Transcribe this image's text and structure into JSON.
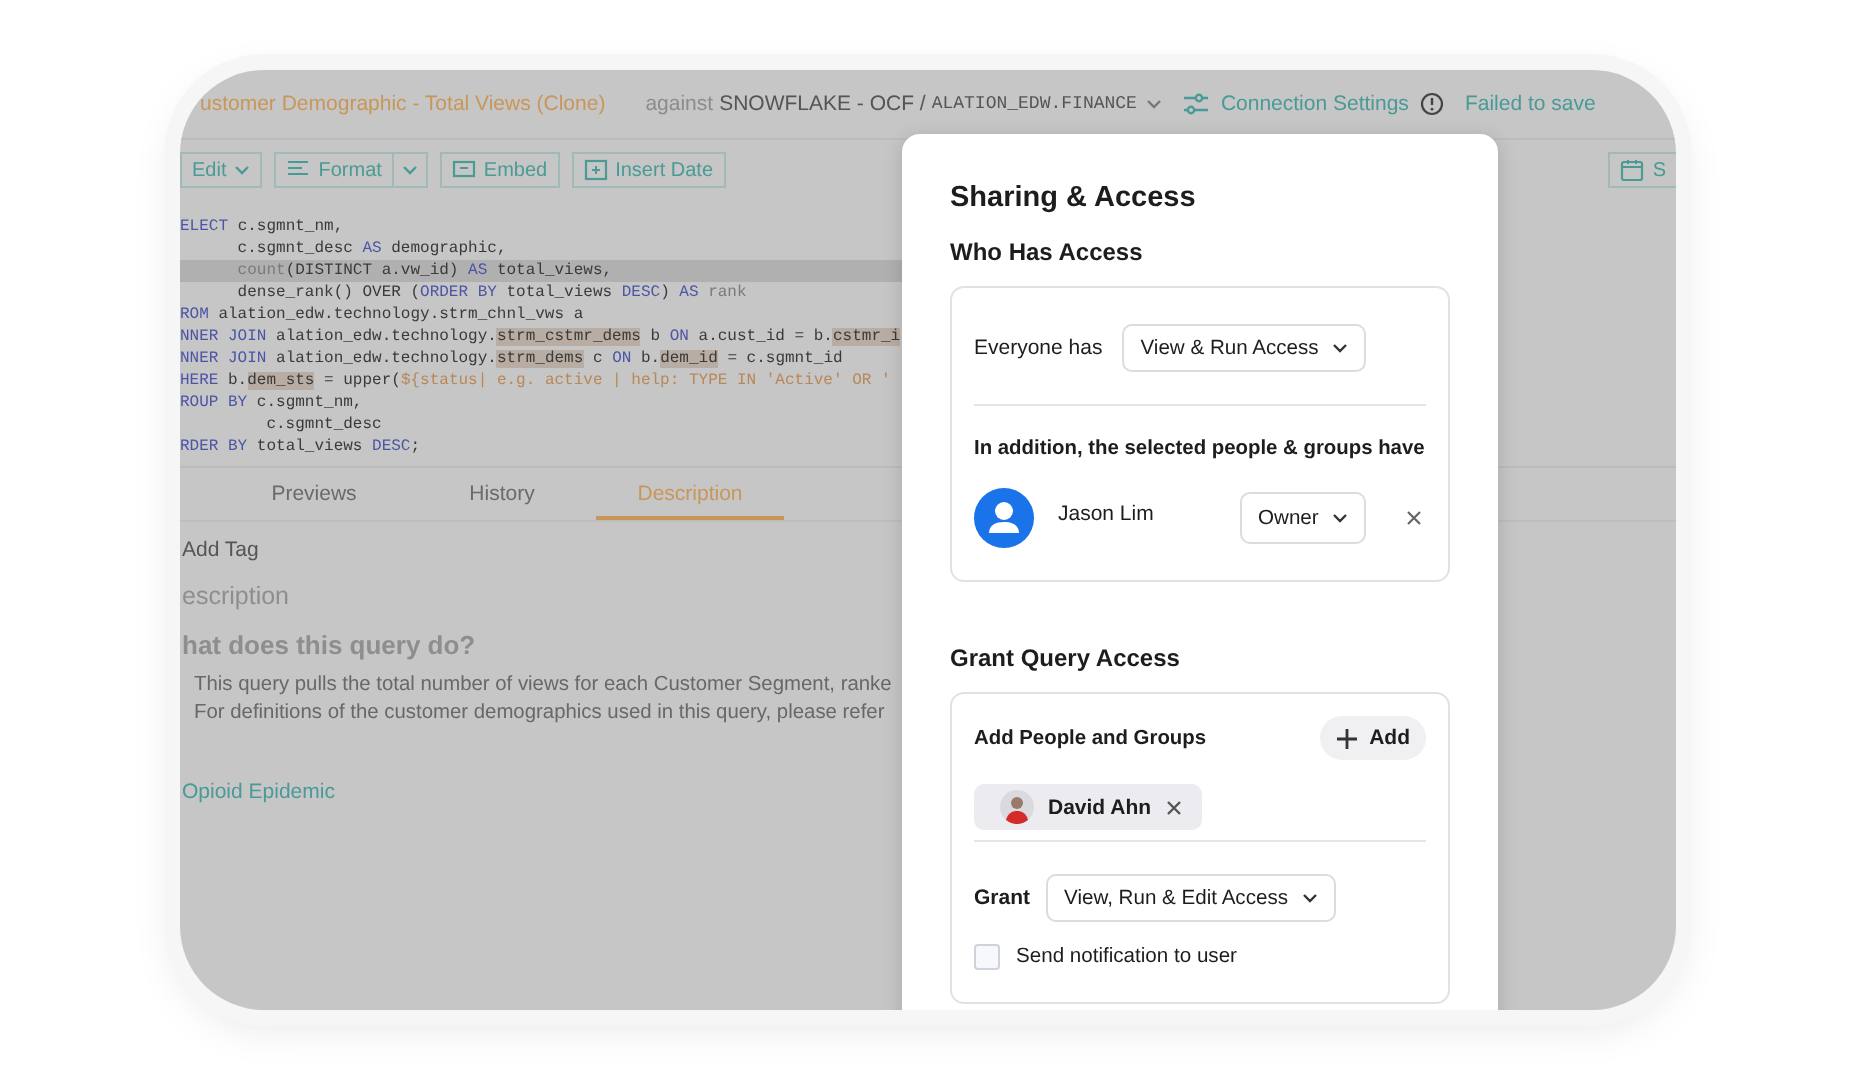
{
  "editor": {
    "title": "ustomer Demographic - Total Views (Clone)",
    "against": "against",
    "connection": "SNOWFLAKE - OCF /",
    "schema": "ALATION_EDW.FINANCE",
    "connection_settings": "Connection Settings",
    "save_status": "Failed to save",
    "toolbar": [
      {
        "label": "Edit",
        "kind": "dropdown"
      },
      {
        "label": "Format",
        "kind": "split"
      },
      {
        "label": "Embed",
        "kind": "embed"
      },
      {
        "label": "Insert Date",
        "kind": "date"
      }
    ],
    "toolbar_right": {
      "label": "S",
      "kind": "calendar"
    },
    "code_lines": [
      {
        "highlighted": false,
        "segments": [
          {
            "kind": "kw",
            "text": "ELECT"
          },
          {
            "kind": "plain",
            "text": " c.sgmnt_nm,"
          }
        ]
      },
      {
        "highlighted": false,
        "segments": [
          {
            "kind": "plain",
            "text": "      c.sgmnt_desc "
          },
          {
            "kind": "kw",
            "text": "AS"
          },
          {
            "kind": "plain",
            "text": " demographic,"
          }
        ]
      },
      {
        "highlighted": true,
        "segments": [
          {
            "kind": "fn",
            "text": "      count"
          },
          {
            "kind": "plain",
            "text": "(DISTINCT a.vw_id) "
          },
          {
            "kind": "kw",
            "text": "AS"
          },
          {
            "kind": "plain",
            "text": " total_views,"
          }
        ]
      },
      {
        "highlighted": false,
        "segments": [
          {
            "kind": "plain",
            "text": "      dense_rank() OVER ("
          },
          {
            "kind": "kw",
            "text": "ORDER BY"
          },
          {
            "kind": "plain",
            "text": " total_views "
          },
          {
            "kind": "kw",
            "text": "DESC"
          },
          {
            "kind": "plain",
            "text": ") "
          },
          {
            "kind": "kw",
            "text": "AS"
          },
          {
            "kind": "fn",
            "text": " rank"
          }
        ]
      },
      {
        "highlighted": false,
        "segments": [
          {
            "kind": "kw",
            "text": "ROM"
          },
          {
            "kind": "plain",
            "text": " alation_edw.technology.strm_chnl_vws a"
          }
        ]
      },
      {
        "highlighted": false,
        "segments": [
          {
            "kind": "kw",
            "text": "NNER JOIN"
          },
          {
            "kind": "plain",
            "text": " alation_edw.technology."
          },
          {
            "kind": "mark",
            "text": "strm_cstmr_dems"
          },
          {
            "kind": "plain",
            "text": " b "
          },
          {
            "kind": "kw",
            "text": "ON"
          },
          {
            "kind": "plain",
            "text": " a.cust_id = b."
          },
          {
            "kind": "mark",
            "text": "cstmr_i"
          }
        ]
      },
      {
        "highlighted": false,
        "segments": [
          {
            "kind": "kw",
            "text": "NNER JOIN"
          },
          {
            "kind": "plain",
            "text": " alation_edw.technology."
          },
          {
            "kind": "mark",
            "text": "strm_dems"
          },
          {
            "kind": "plain",
            "text": " c "
          },
          {
            "kind": "kw",
            "text": "ON"
          },
          {
            "kind": "plain",
            "text": " b."
          },
          {
            "kind": "mark",
            "text": "dem_id"
          },
          {
            "kind": "plain",
            "text": " = c.sgmnt_id"
          }
        ]
      },
      {
        "highlighted": false,
        "segments": [
          {
            "kind": "kw",
            "text": "HERE"
          },
          {
            "kind": "plain",
            "text": " b."
          },
          {
            "kind": "mark",
            "text": "dem_sts"
          },
          {
            "kind": "plain",
            "text": " = upper("
          },
          {
            "kind": "param",
            "text": "${status| e.g. active | help: TYPE IN 'Active' OR '"
          }
        ]
      },
      {
        "highlighted": false,
        "segments": [
          {
            "kind": "kw",
            "text": "ROUP BY"
          },
          {
            "kind": "plain",
            "text": " c.sgmnt_nm,"
          }
        ]
      },
      {
        "highlighted": false,
        "segments": [
          {
            "kind": "plain",
            "text": "         c.sgmnt_desc"
          }
        ]
      },
      {
        "highlighted": false,
        "segments": [
          {
            "kind": "kw",
            "text": "RDER BY"
          },
          {
            "kind": "plain",
            "text": " total_views "
          },
          {
            "kind": "kw",
            "text": "DESC"
          },
          {
            "kind": "plain",
            "text": ";"
          }
        ]
      }
    ],
    "tabs": [
      {
        "label": "Previews",
        "selected": false
      },
      {
        "label": "History",
        "selected": false
      },
      {
        "label": "Description",
        "selected": true
      }
    ],
    "add_tag": "Add Tag",
    "section_title": "escription",
    "heading": "hat does this query do?",
    "paragraph_lines": [
      "This query pulls the total number of views for each Customer Segment, ranke",
      "For definitions of the customer demographics used in this query, please refer"
    ],
    "link": "Opioid Epidemic"
  },
  "dialog": {
    "title": "Sharing & Access",
    "who_has_access": {
      "heading": "Who Has Access",
      "everyone_label": "Everyone has",
      "everyone_access": "View & Run Access",
      "addition_label": "In addition, the selected people & groups have",
      "people": [
        {
          "name": "Jason Lim",
          "role": "Owner"
        }
      ]
    },
    "grant": {
      "heading": "Grant Query Access",
      "add_label": "Add People and Groups",
      "add_button": "Add",
      "chips": [
        {
          "name": "David Ahn"
        }
      ],
      "grant_label": "Grant",
      "grant_access": "View, Run & Edit Access",
      "notify": {
        "label": "Send notification to user",
        "checked": false
      }
    }
  }
}
